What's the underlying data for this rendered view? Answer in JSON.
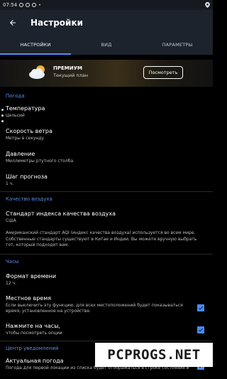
{
  "status_bar": {
    "time": "07:54",
    "icons_left": [
      "whatsapp-icon",
      "sync-icon",
      "circle-icon",
      "dot-icon"
    ],
    "icons_right": [
      "location-icon"
    ]
  },
  "app_bar": {
    "title": "Настройки"
  },
  "tabs": [
    {
      "label": "НАСТРОЙКИ",
      "active": true
    },
    {
      "label": "ВИД",
      "active": false
    },
    {
      "label": "ПАРАМЕТРЫ",
      "active": false
    }
  ],
  "premium": {
    "title": "ПРЕМИУМ",
    "subtitle": "Текущий план",
    "button": "Посмотреть"
  },
  "weather_section": {
    "header": "Погода",
    "items": [
      {
        "title": "Температура",
        "sub": "Цельсий"
      },
      {
        "title": "Скорость ветра",
        "sub": "Метры в секунду"
      },
      {
        "title": "Давление",
        "sub": "Миллиметры ртутного столба"
      },
      {
        "title": "Шаг прогноза",
        "sub": "1 ч."
      }
    ]
  },
  "air_section": {
    "header": "Качество воздуха",
    "item_title": "Стандарт индекса качества воздуха",
    "item_sub": "США",
    "description_1": "Американский стандарт AQI (индекс качества воздуха) используется во всем мире.",
    "description_2": "Собственные стандарты существуют в Китае и Индии. Вы можете вручную выбрать",
    "description_3": "тот, который подходит вам."
  },
  "clock_section": {
    "header": "Часы",
    "time_format_title": "Формат времени",
    "time_format_sub": "12 ч.",
    "local_time_title": "Местное время",
    "local_time_sub_1": "Если выключить эту функцию, для всех местоположений будет показываться",
    "local_time_sub_2": "время, установленное на устройстве.",
    "local_time_checked": true,
    "tap_clock_title": "Нажмите на часы,",
    "tap_clock_sub": "чтобы посмотреть опции",
    "tap_clock_checked": true
  },
  "notifications_section": {
    "header": "Центр уведомлений",
    "current_weather_title": "Актуальная погода",
    "current_weather_sub": "Погода для первой локации из списка будет отображаться в строке состояния и",
    "current_weather_checked": true
  },
  "watermark": {
    "text": "PCPROGS.NET"
  },
  "colors": {
    "accent": "#4f8ff7",
    "section_header": "#5a8de8",
    "app_bar": "#1c232c",
    "background": "#000000"
  }
}
